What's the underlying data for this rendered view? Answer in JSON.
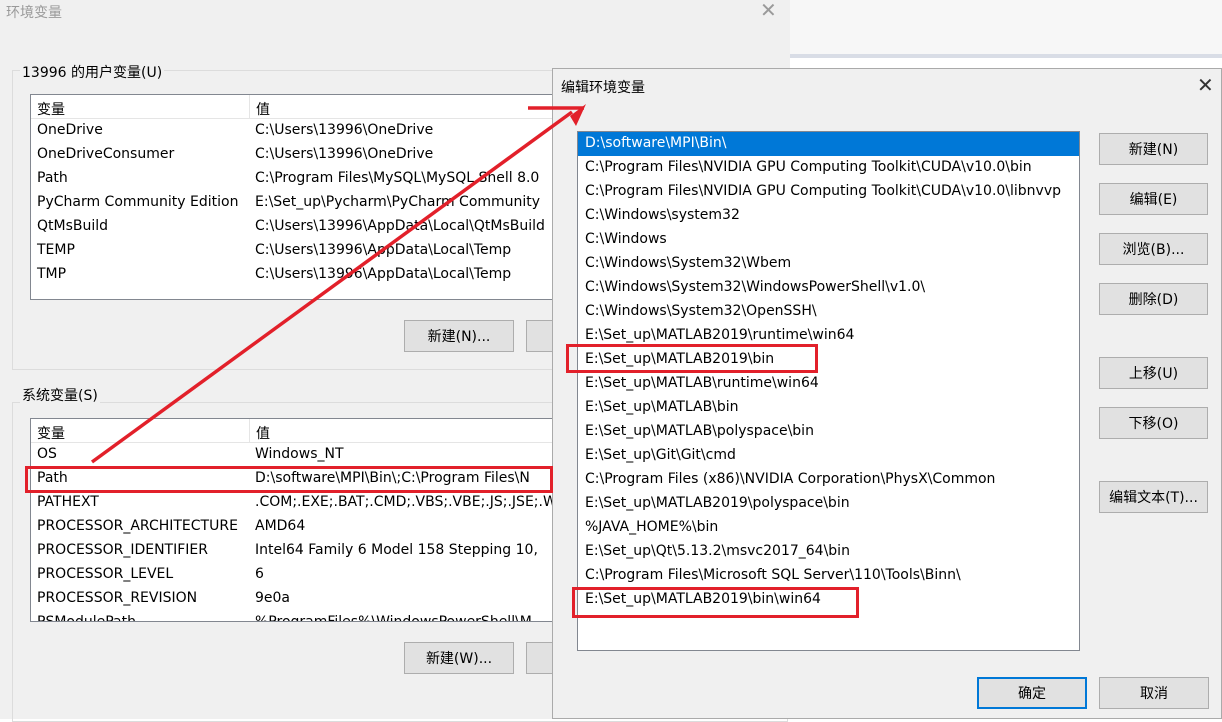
{
  "background_window": {
    "title": "环境变量",
    "user_section": {
      "label": "13996 的用户变量(U)",
      "headers": [
        "变量",
        "值"
      ],
      "rows": [
        [
          "OneDrive",
          "C:\\Users\\13996\\OneDrive"
        ],
        [
          "OneDriveConsumer",
          "C:\\Users\\13996\\OneDrive"
        ],
        [
          "Path",
          "C:\\Program Files\\MySQL\\MySQL Shell 8.0"
        ],
        [
          "PyCharm Community Edition",
          "E:\\Set_up\\Pycharm\\PyCharm Community"
        ],
        [
          "QtMsBuild",
          "C:\\Users\\13996\\AppData\\Local\\QtMsBuild"
        ],
        [
          "TEMP",
          "C:\\Users\\13996\\AppData\\Local\\Temp"
        ],
        [
          "TMP",
          "C:\\Users\\13996\\AppData\\Local\\Temp"
        ]
      ],
      "new_button": "新建(N)..."
    },
    "system_section": {
      "label": "系统变量(S)",
      "headers": [
        "变量",
        "值"
      ],
      "rows": [
        [
          "OS",
          "Windows_NT"
        ],
        [
          "Path",
          "D:\\software\\MPI\\Bin\\;C:\\Program Files\\N"
        ],
        [
          "PATHEXT",
          ".COM;.EXE;.BAT;.CMD;.VBS;.VBE;.JS;.JSE;.W"
        ],
        [
          "PROCESSOR_ARCHITECTURE",
          "AMD64"
        ],
        [
          "PROCESSOR_IDENTIFIER",
          "Intel64 Family 6 Model 158 Stepping 10,"
        ],
        [
          "PROCESSOR_LEVEL",
          "6"
        ],
        [
          "PROCESSOR_REVISION",
          "9e0a"
        ],
        [
          "PSModulePath",
          "%ProgramFiles%\\WindowsPowerShell\\M"
        ]
      ],
      "new_button": "新建(W)..."
    }
  },
  "edit_dialog": {
    "title": "编辑环境变量",
    "paths": [
      "D:\\software\\MPI\\Bin\\",
      "C:\\Program Files\\NVIDIA GPU Computing Toolkit\\CUDA\\v10.0\\bin",
      "C:\\Program Files\\NVIDIA GPU Computing Toolkit\\CUDA\\v10.0\\libnvvp",
      "C:\\Windows\\system32",
      "C:\\Windows",
      "C:\\Windows\\System32\\Wbem",
      "C:\\Windows\\System32\\WindowsPowerShell\\v1.0\\",
      "C:\\Windows\\System32\\OpenSSH\\",
      "E:\\Set_up\\MATLAB2019\\runtime\\win64",
      "E:\\Set_up\\MATLAB2019\\bin",
      "E:\\Set_up\\MATLAB\\runtime\\win64",
      "E:\\Set_up\\MATLAB\\bin",
      "E:\\Set_up\\MATLAB\\polyspace\\bin",
      "E:\\Set_up\\Git\\Git\\cmd",
      "C:\\Program Files (x86)\\NVIDIA Corporation\\PhysX\\Common",
      "E:\\Set_up\\MATLAB2019\\polyspace\\bin",
      "%JAVA_HOME%\\bin",
      "E:\\Set_up\\Qt\\5.13.2\\msvc2017_64\\bin",
      "C:\\Program Files\\Microsoft SQL Server\\110\\Tools\\Binn\\",
      "E:\\Set_up\\MATLAB2019\\bin\\win64"
    ],
    "buttons": {
      "new": "新建(N)",
      "edit": "编辑(E)",
      "browse": "浏览(B)...",
      "delete": "删除(D)",
      "move_up": "上移(U)",
      "move_down": "下移(O)",
      "edit_text": "编辑文本(T)...",
      "ok": "确定",
      "cancel": "取消"
    }
  },
  "colors": {
    "selection": "#0078d7",
    "annotation_red": "#e2202a"
  }
}
